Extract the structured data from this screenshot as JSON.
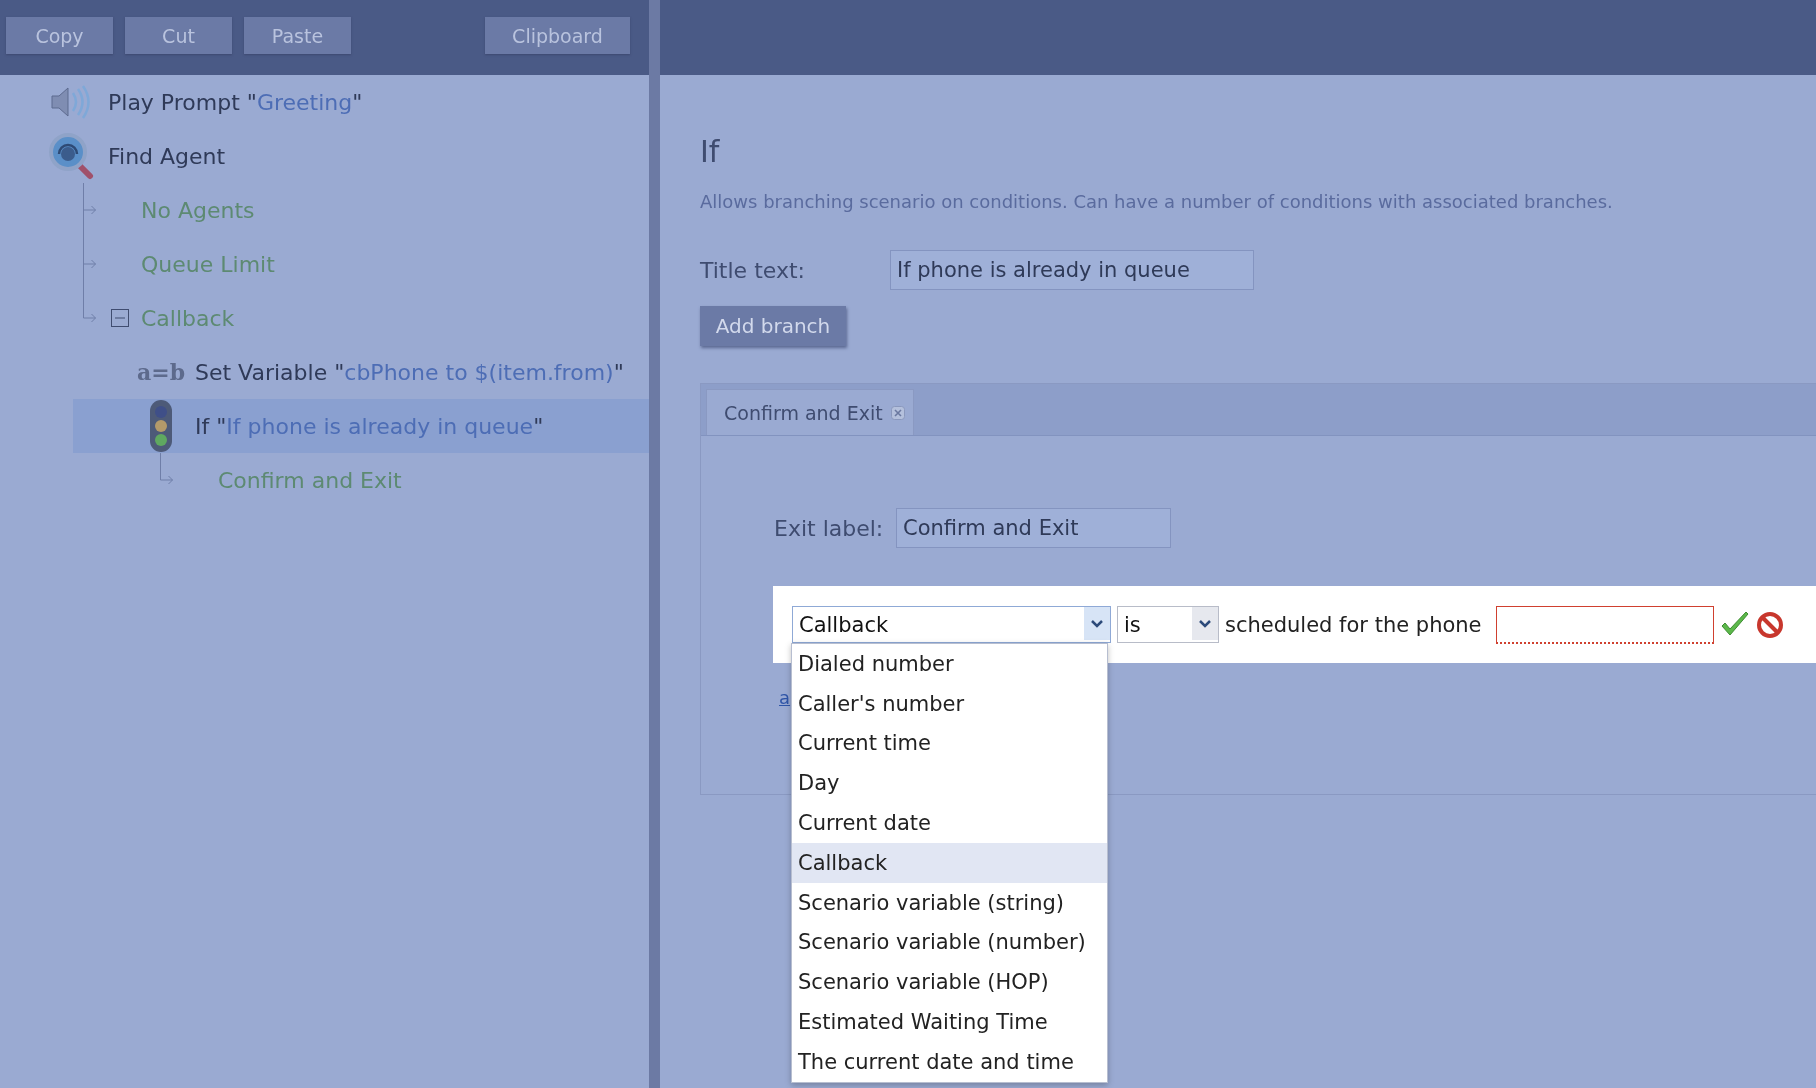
{
  "toolbar": {
    "buttons": [
      "Copy",
      "Cut",
      "Paste"
    ],
    "clipboard_button": "Clipboard"
  },
  "tree": [
    {
      "kind": "prompt",
      "label": "Play Prompt \"",
      "value": "Greeting",
      "close": "\"",
      "selected": false
    },
    {
      "kind": "find_agent",
      "label": "Find Agent",
      "selected": false,
      "children": [
        {
          "kind": "exit",
          "label": "No Agents",
          "selected": false
        },
        {
          "kind": "exit",
          "label": "Queue Limit",
          "selected": false
        },
        {
          "kind": "exit",
          "label": "Callback",
          "expanded": true,
          "selected": false,
          "children": [
            {
              "kind": "set_variable",
              "icon_text": "a=b",
              "label": "Set Variable \"",
              "value": "cbPhone to $(item.from)",
              "close": "\"",
              "selected": false
            },
            {
              "kind": "if",
              "label": "If \"",
              "value": "If phone is already in queue",
              "close": "\"",
              "selected": true,
              "children": [
                {
                  "kind": "exit",
                  "label": "Confirm and Exit",
                  "selected": false
                }
              ]
            }
          ]
        }
      ]
    }
  ],
  "editor": {
    "title": "If",
    "description": "Allows branching scenario on conditions. Can have a number of conditions with associated branches.",
    "title_field": {
      "label": "Title text:",
      "value": "If phone is already in queue"
    },
    "add_branch_button": "Add branch",
    "tabs": [
      {
        "label": "Confirm and Exit",
        "selected": true
      }
    ],
    "exit_field": {
      "label": "Exit label:",
      "value": "Confirm and Exit"
    },
    "condition": {
      "variable_select": "Callback",
      "operator_select": "is",
      "text": "scheduled for the phone",
      "phone_field": {
        "invalid": true
      }
    },
    "link": "a",
    "dropdown": [
      {
        "label": "Dialed number",
        "selected": false
      },
      {
        "label": "Caller's number",
        "selected": false
      },
      {
        "label": "Current time",
        "selected": false
      },
      {
        "label": "Day",
        "selected": false
      },
      {
        "label": "Current date",
        "selected": false
      },
      {
        "label": "Callback",
        "selected": true
      },
      {
        "label": "Scenario variable (string)",
        "selected": false
      },
      {
        "label": "Scenario variable (number)",
        "selected": false
      },
      {
        "label": "Scenario variable (HOP)",
        "selected": false
      },
      {
        "label": "Estimated Waiting Time",
        "selected": false
      },
      {
        "label": "The current date and time",
        "selected": false
      }
    ]
  }
}
